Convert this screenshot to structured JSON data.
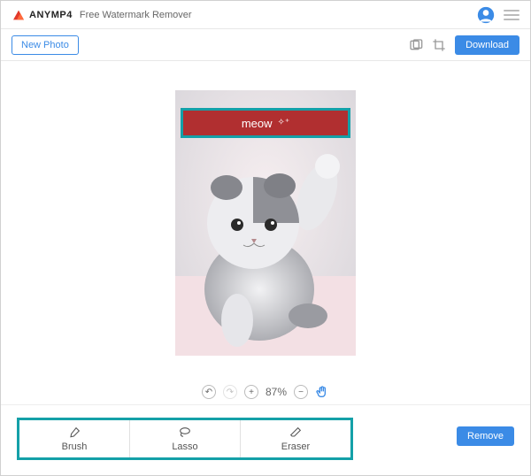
{
  "header": {
    "brand": "ANYMP4",
    "app_name": "Free Watermark Remover"
  },
  "subheader": {
    "new_photo_label": "New Photo",
    "download_label": "Download"
  },
  "canvas": {
    "watermark_text": "meow",
    "zoom_text": "87%"
  },
  "tools": {
    "brush_label": "Brush",
    "lasso_label": "Lasso",
    "eraser_label": "Eraser"
  },
  "footer": {
    "remove_label": "Remove"
  },
  "colors": {
    "accent": "#3b8be6",
    "highlight": "#14a0a8",
    "selection_fill": "#b12f30"
  }
}
